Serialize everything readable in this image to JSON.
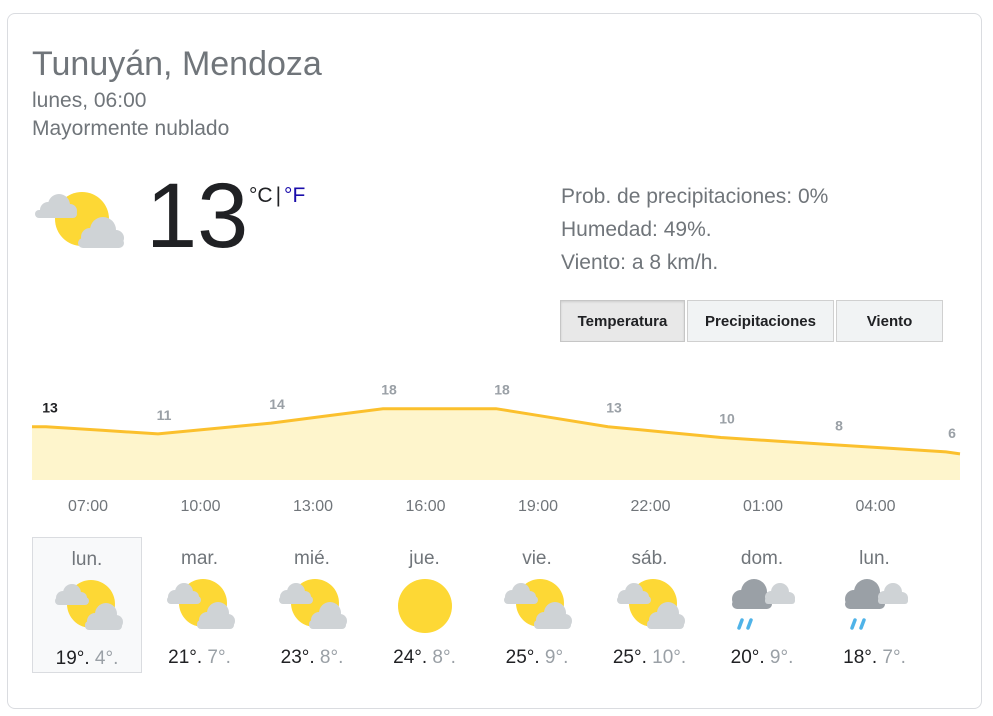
{
  "location": "Tunuyán, Mendoza",
  "datetime": "lunes, 06:00",
  "condition": "Mayormente nublado",
  "current": {
    "temp": "13",
    "unit_c": "°C",
    "separator": "|",
    "unit_f": "°F",
    "icon": "partly-cloudy-icon"
  },
  "details": {
    "precip": "Prob. de precipitaciones: 0%",
    "humidity": "Humedad: 49%.",
    "wind": "Viento: a 8 km/h."
  },
  "tabs": [
    {
      "label": "Temperatura",
      "active": true
    },
    {
      "label": "Precipitaciones",
      "active": false
    },
    {
      "label": "Viento",
      "active": false
    }
  ],
  "colors": {
    "line": "#fbc02d",
    "fill": "#fef5cc",
    "sun": "#fdd835",
    "cloud": "#cfd3d6",
    "rain": "#4fb3e8",
    "link": "#1a0dab"
  },
  "chart_data": {
    "type": "area",
    "labels": [
      "13",
      "11",
      "14",
      "18",
      "18",
      "13",
      "10",
      "8",
      "6"
    ],
    "values": [
      13,
      11,
      14,
      18,
      18,
      13,
      10,
      8,
      6
    ],
    "hours": [
      "07:00",
      "10:00",
      "13:00",
      "16:00",
      "19:00",
      "22:00",
      "01:00",
      "04:00"
    ]
  },
  "forecast": [
    {
      "day": "lun.",
      "hi": "19°",
      "lo": "4°",
      "icon": "partly-cloudy-icon",
      "selected": true
    },
    {
      "day": "mar.",
      "hi": "21°",
      "lo": "7°",
      "icon": "partly-cloudy-icon"
    },
    {
      "day": "mié.",
      "hi": "23°",
      "lo": "8°",
      "icon": "partly-cloudy-icon"
    },
    {
      "day": "jue.",
      "hi": "24°",
      "lo": "8°",
      "icon": "sunny-icon"
    },
    {
      "day": "vie.",
      "hi": "25°",
      "lo": "9°",
      "icon": "partly-cloudy-icon"
    },
    {
      "day": "sáb.",
      "hi": "25°",
      "lo": "10°",
      "icon": "partly-cloudy-icon"
    },
    {
      "day": "dom.",
      "hi": "20°",
      "lo": "9°",
      "icon": "rain-icon"
    },
    {
      "day": "lun.",
      "hi": "18°",
      "lo": "7°",
      "icon": "rain-icon"
    }
  ]
}
